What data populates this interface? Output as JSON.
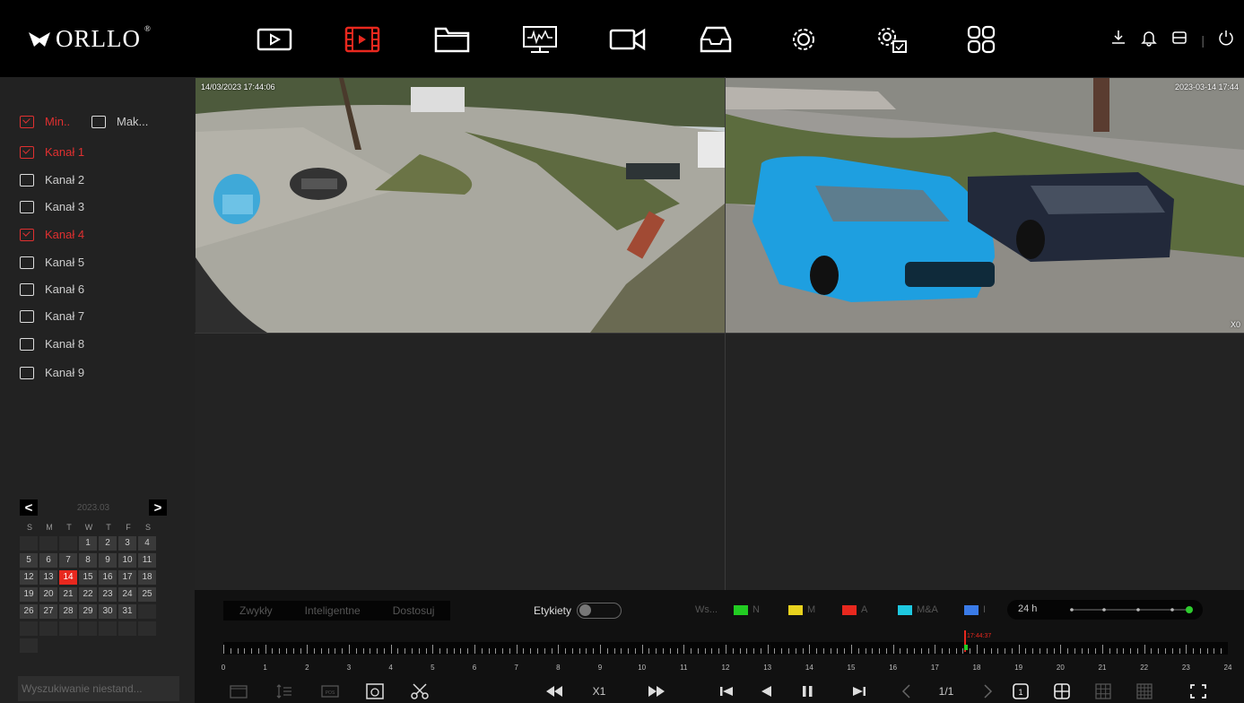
{
  "header": {
    "logo_text": "ORLLO",
    "logo_sup": "®",
    "menu": [
      "playback-icon",
      "video-playback-icon",
      "folder-icon",
      "monitor-icon",
      "camera-icon",
      "inbox-icon",
      "settings-icon",
      "advanced-settings-icon",
      "apps-icon"
    ],
    "right_icons": [
      "download-icon",
      "bell-icon",
      "storage-icon",
      "power-icon"
    ]
  },
  "sidebar": {
    "stream_main": "Min..",
    "stream_sub": "Mak...",
    "channels": [
      {
        "label": "Kanał 1",
        "checked": true
      },
      {
        "label": "Kanał 2",
        "checked": false
      },
      {
        "label": "Kanał 3",
        "checked": false
      },
      {
        "label": "Kanał 4",
        "checked": true
      },
      {
        "label": "Kanał 5",
        "checked": false
      },
      {
        "label": "Kanał 6",
        "checked": false
      },
      {
        "label": "Kanał 7",
        "checked": false
      },
      {
        "label": "Kanał 8",
        "checked": false
      },
      {
        "label": "Kanał 9",
        "checked": false
      }
    ],
    "calendar": {
      "prev": "<",
      "next": ">",
      "month": "2023.03",
      "weekdays": [
        "S",
        "M",
        "T",
        "W",
        "T",
        "F",
        "S"
      ],
      "days": [
        "",
        "",
        "",
        "1",
        "2",
        "3",
        "4",
        "5",
        "6",
        "7",
        "8",
        "9",
        "10",
        "11",
        "12",
        "13",
        "14",
        "15",
        "16",
        "17",
        "18",
        "19",
        "20",
        "21",
        "22",
        "23",
        "24",
        "25",
        "26",
        "27",
        "28",
        "29",
        "30",
        "31",
        "",
        "",
        "",
        "",
        "",
        "",
        "",
        "",
        ""
      ],
      "selected": "14"
    },
    "search_placeholder": "Wyszukiwanie niestand..."
  },
  "video": {
    "cam1_time": "14/03/2023 17:44:06",
    "cam2_time": "2023-03-14  17:44",
    "cam2_corner": "X0"
  },
  "bottom": {
    "tabs": [
      "Zwykły",
      "Inteligentne",
      "Dostosuj"
    ],
    "tags_label": "Etykiety",
    "legend": [
      {
        "label": "Ws...",
        "color": ""
      },
      {
        "label": "N",
        "color": "#22cc22"
      },
      {
        "label": "M",
        "color": "#e8d21e"
      },
      {
        "label": "A",
        "color": "#e8281e"
      },
      {
        "label": "M&A",
        "color": "#1ec8e0"
      },
      {
        "label": "I",
        "color": "#3a7be8"
      }
    ],
    "range_label": "24 h",
    "cursor_time": "17:44:37",
    "hours": [
      "0",
      "1",
      "2",
      "3",
      "4",
      "5",
      "6",
      "7",
      "8",
      "9",
      "10",
      "11",
      "12",
      "13",
      "14",
      "15",
      "16",
      "17",
      "18",
      "19",
      "20",
      "21",
      "22",
      "23",
      "24"
    ],
    "speed": "X1",
    "page": "1/1"
  }
}
